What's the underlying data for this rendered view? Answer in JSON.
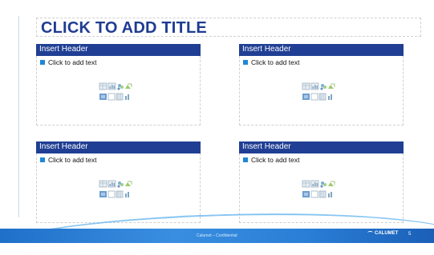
{
  "slide": {
    "title": "CLICK TO ADD TITLE",
    "panels": [
      {
        "header": "Insert Header",
        "body": "Click to add text"
      },
      {
        "header": "Insert Header",
        "body": "Click to add text"
      },
      {
        "header": "Insert Header",
        "body": "Click to add text"
      },
      {
        "header": "Insert Header",
        "body": "Click to add text"
      }
    ],
    "content_icons": [
      "insert-table-icon",
      "insert-chart-icon",
      "insert-smartart-icon",
      "insert-picture-icon",
      "insert-clipart-icon",
      "insert-media-icon"
    ]
  },
  "footer": {
    "confidential": "Calumet – Confidential",
    "brand": "CALUMET",
    "page_number": "5"
  },
  "colors": {
    "title": "#1f3c93",
    "header_bar": "#203f94",
    "bullet": "#1e88d6",
    "footer_band": "#2a7fd6"
  }
}
